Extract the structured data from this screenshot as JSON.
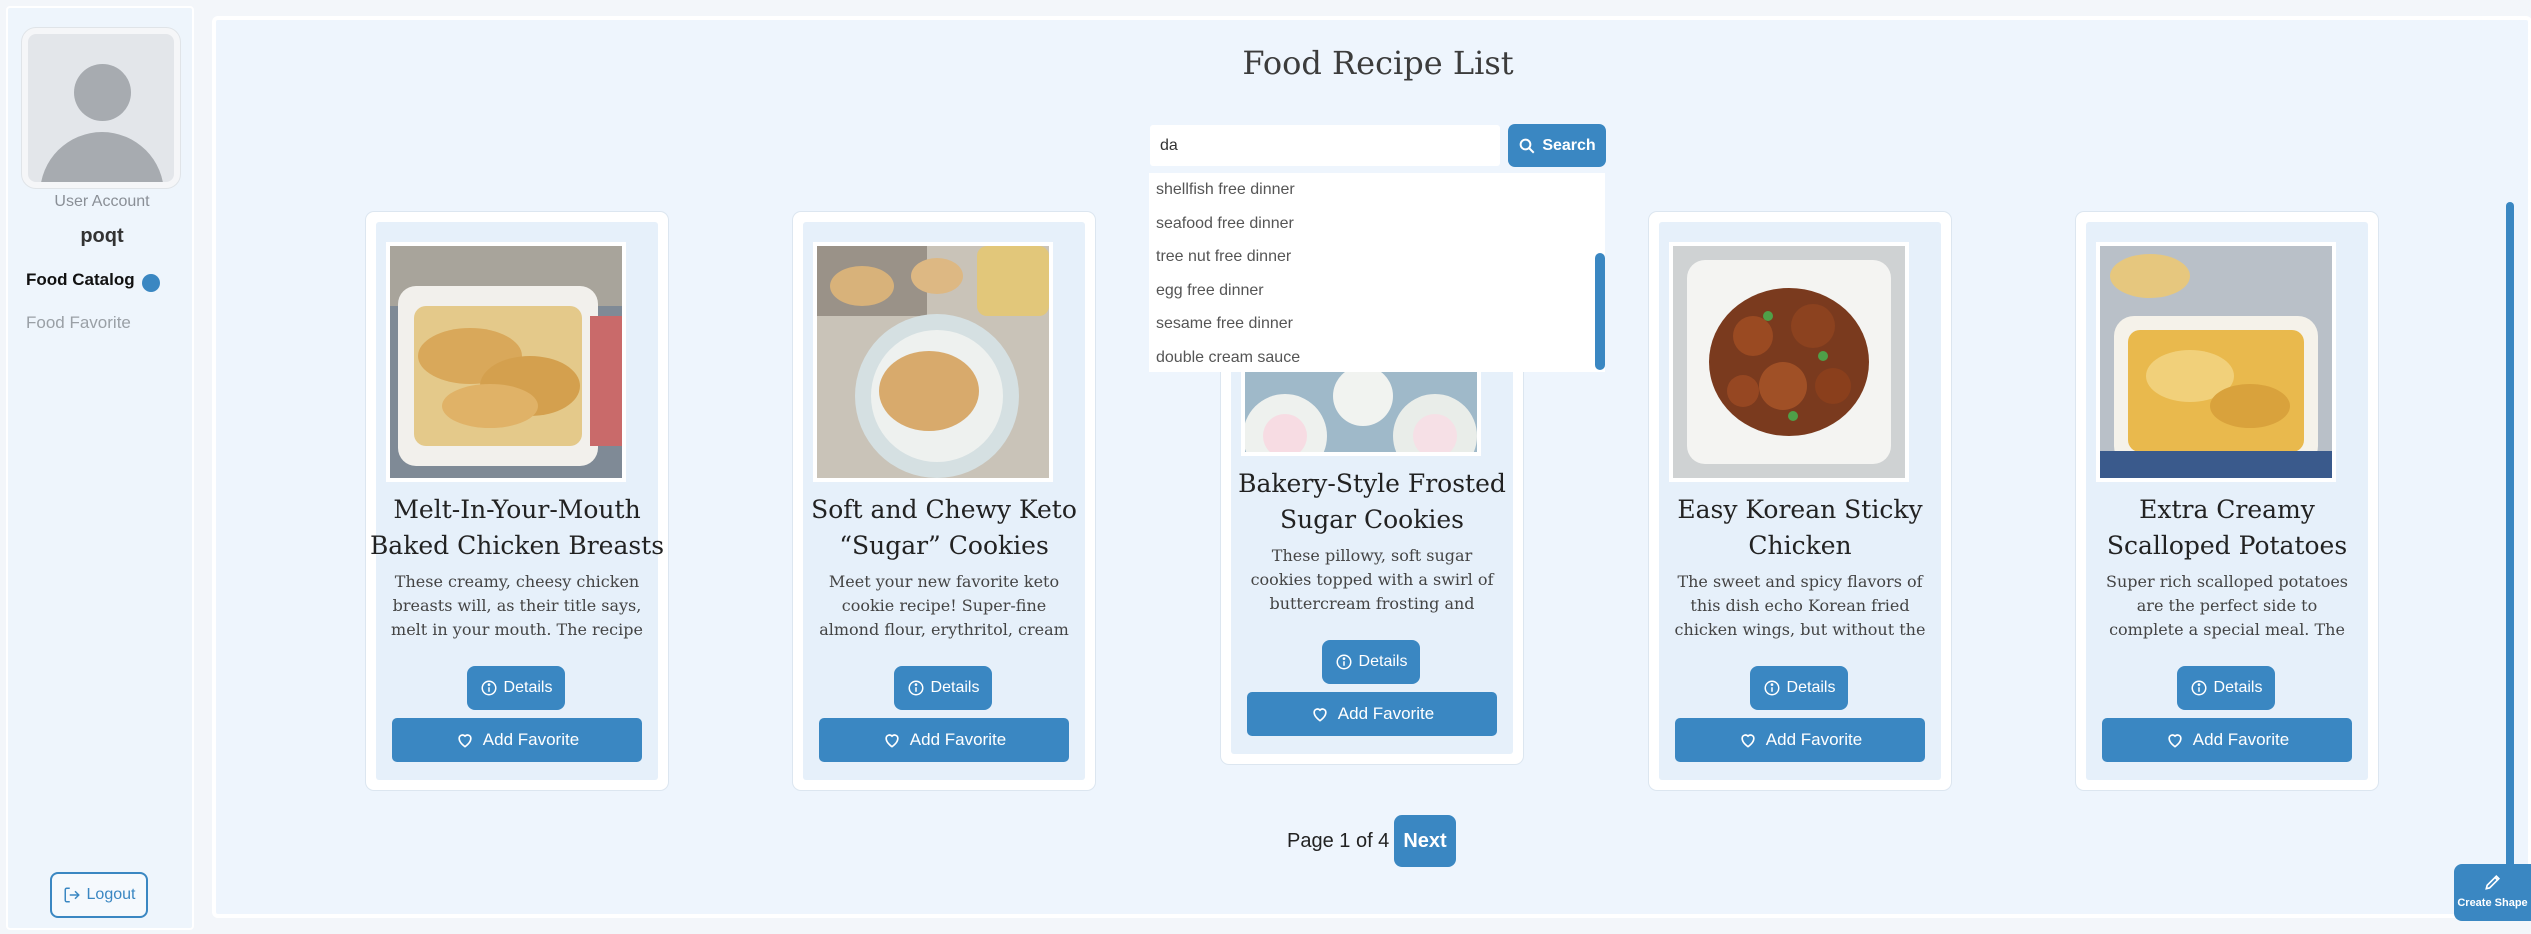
{
  "sidebar": {
    "account_label": "User Account",
    "username": "poqt",
    "nav": {
      "catalog": "Food Catalog",
      "favorite": "Food Favorite"
    },
    "logout_label": "Logout"
  },
  "main": {
    "title": "Food Recipe List",
    "search": {
      "value": "da",
      "button_label": "Search"
    },
    "suggestions": [
      "shellfish free dinner",
      "seafood free dinner",
      "tree nut free dinner",
      "egg free dinner",
      "sesame free dinner",
      "double cream sauce"
    ],
    "recipes": [
      {
        "title_line1": "Melt-In-Your-Mouth",
        "title_line2": "Baked Chicken Breasts",
        "description": "These creamy, cheesy chicken breasts will, as their title says, melt in your mouth. The recipe is ..."
      },
      {
        "title_line1": "Soft and Chewy Keto",
        "title_line2": "“Sugar” Cookies",
        "description": "Meet your new favorite keto cookie recipe! Super-fine almond flour, erythritol, cream cheese..."
      },
      {
        "title_line1": "Bakery-Style Frosted",
        "title_line2": "Sugar Cookies",
        "description": "These pillowy, soft sugar cookies topped with a swirl of buttercream frosting and colorfu..."
      },
      {
        "title_line1": "Easy Korean Sticky",
        "title_line2": "Chicken",
        "description": "The sweet and spicy flavors of this dish echo Korean fried chicken wings, but without the hassle of..."
      },
      {
        "title_line1": "Extra Creamy",
        "title_line2": "Scalloped Potatoes",
        "description": "Super rich scalloped potatoes are the perfect side to complete a special meal. The recipe is a..."
      }
    ],
    "details_label": "Details",
    "add_favorite_label": "Add Favorite",
    "pagination": {
      "info": "Page 1 of 4",
      "next_label": "Next"
    }
  },
  "create_shape_label": "Create Shape",
  "colors": {
    "accent": "#3a87c2",
    "panel": "#eef5fd",
    "card_inner": "#e6f0fa"
  },
  "icons": [
    "user-avatar-icon",
    "logout-icon",
    "search-icon",
    "info-icon",
    "heart-icon",
    "pencil-icon"
  ]
}
